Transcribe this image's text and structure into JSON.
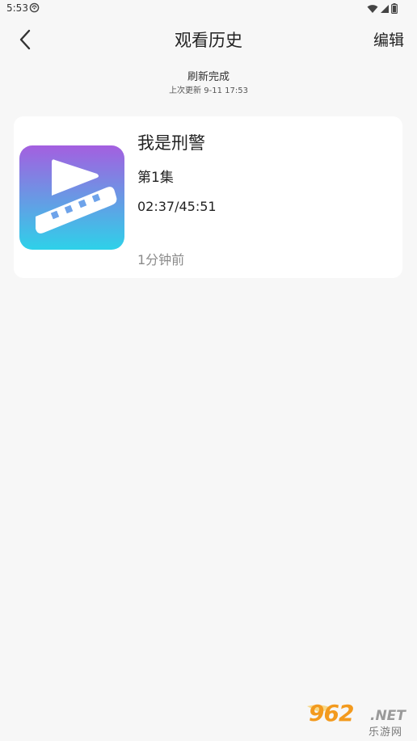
{
  "status_bar": {
    "time": "5:53",
    "icons": [
      "notification-icon",
      "wifi-icon",
      "signal-icon",
      "battery-icon"
    ]
  },
  "header": {
    "title": "观看历史",
    "edit_label": "编辑",
    "back_icon": "chevron-left-icon"
  },
  "refresh": {
    "status": "刷新完成",
    "last_update": "上次更新 9-11 17:53"
  },
  "history": [
    {
      "title": "我是刑警",
      "episode": "第1集",
      "progress": "02:37/45:51",
      "ago": "1分钟前",
      "thumbnail_icon": "video-play-icon"
    }
  ],
  "watermark": {
    "number": "962",
    "suffix": ".NET",
    "text": "乐游网"
  },
  "colors": {
    "background": "#f7f7f7",
    "card": "#ffffff",
    "thumb_gradient_top": "#a45fe0",
    "thumb_gradient_bottom": "#2ed1e9",
    "muted_text": "#8a8a8a"
  }
}
